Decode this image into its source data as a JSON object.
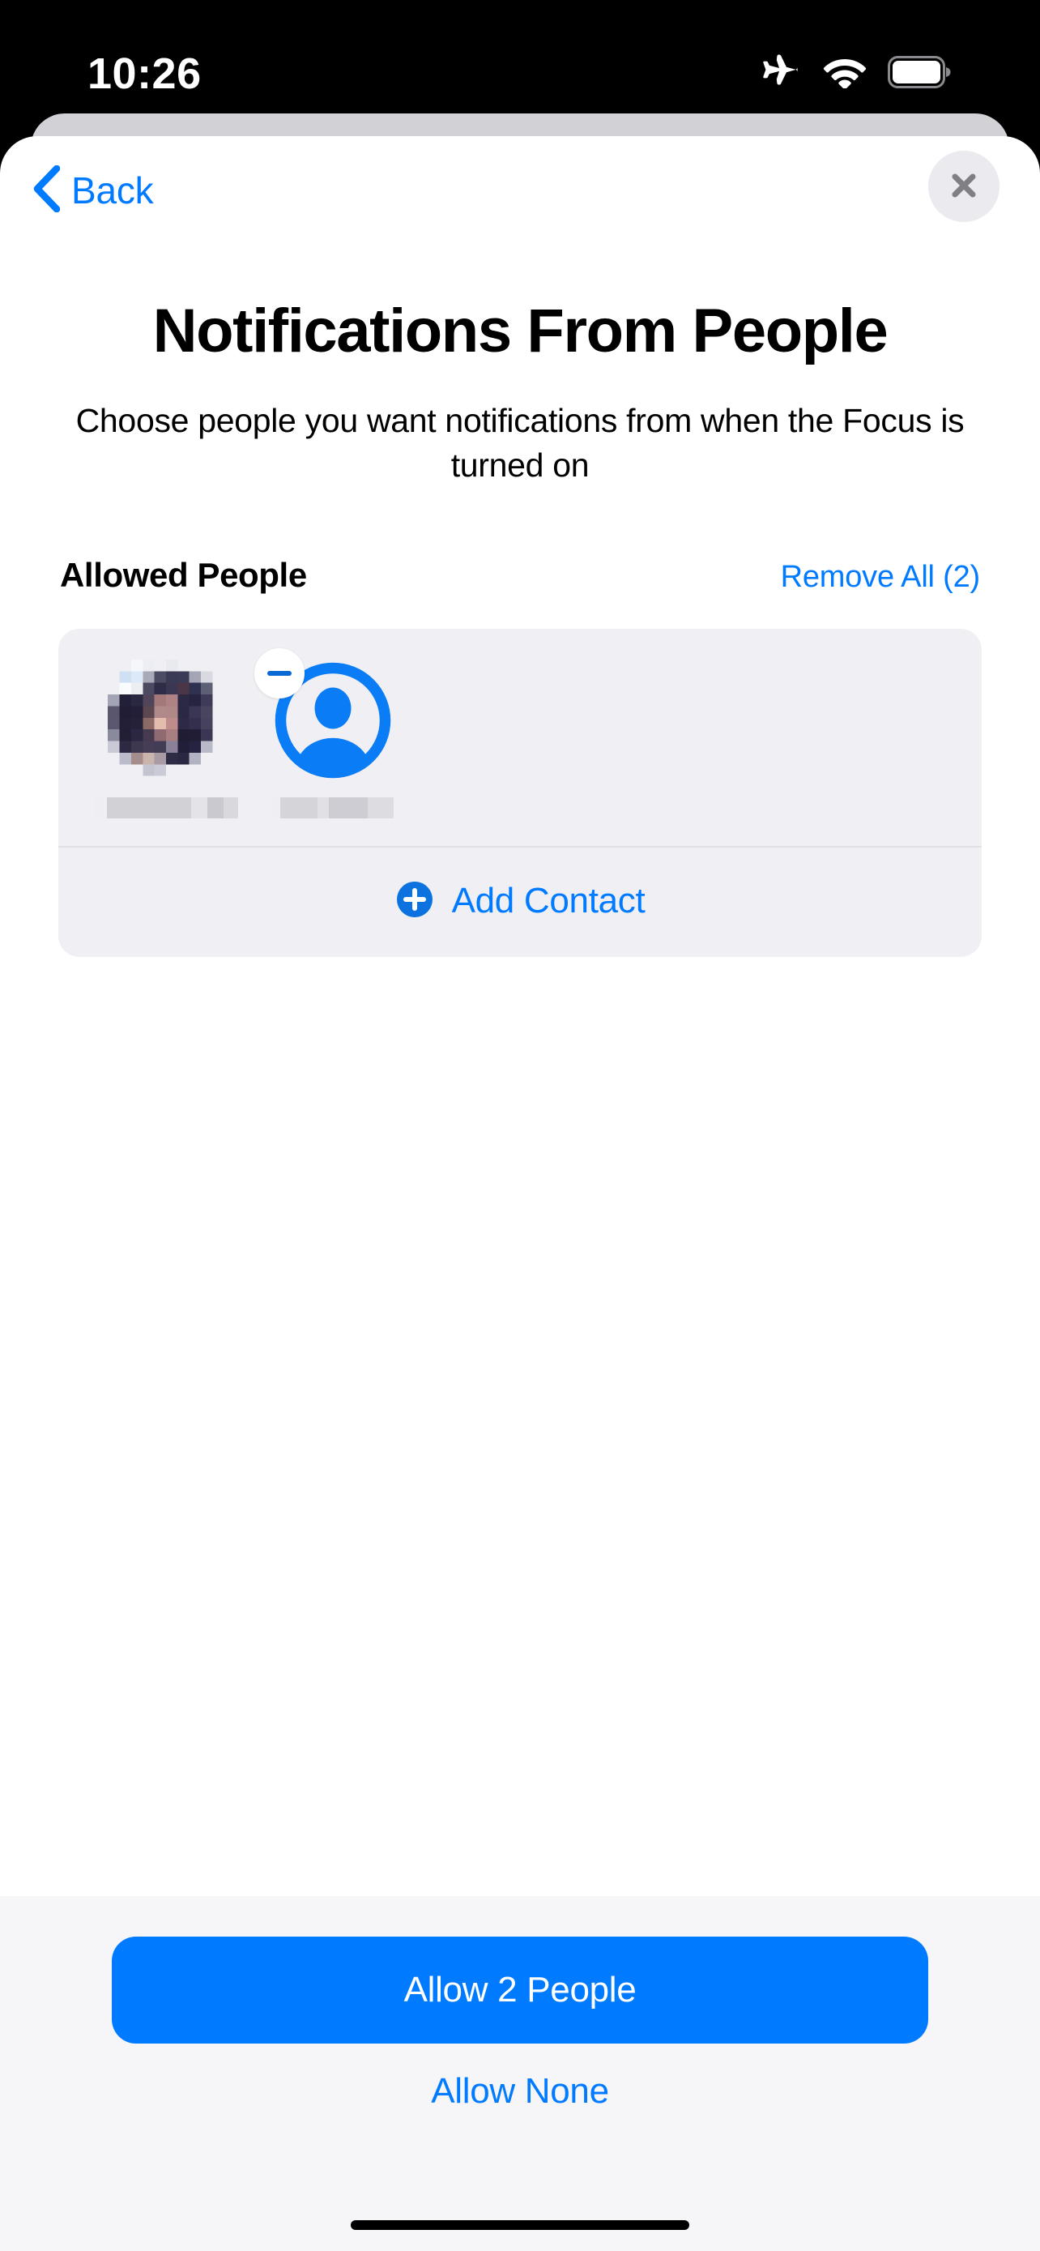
{
  "status_bar": {
    "time": "10:26",
    "icons": [
      "airplane-mode-icon",
      "wifi-icon",
      "battery-icon"
    ],
    "background_color": "#000000",
    "foreground_color": "#FFFFFF"
  },
  "nav": {
    "back_label": "Back",
    "back_icon": "chevron-left-icon",
    "close_icon": "close-icon",
    "accent_color": "#007AFF"
  },
  "header": {
    "title": "Notifications From People",
    "subtitle": "Choose people you want notifications from when the Focus is turned on"
  },
  "section": {
    "title": "Allowed People",
    "remove_all_label": "Remove All (2)"
  },
  "contacts": {
    "items": [
      {
        "name": "",
        "name_redacted": true,
        "avatar_type": "photo",
        "remove_badge": false
      },
      {
        "name": "",
        "name_redacted": true,
        "avatar_type": "placeholder",
        "remove_badge": true,
        "remove_icon": "minus-icon"
      }
    ],
    "add_contact_label": "Add Contact",
    "add_contact_icon": "plus-circle-icon",
    "card_color": "#F0F0F4"
  },
  "footer": {
    "primary_label": "Allow 2 People",
    "secondary_label": "Allow None",
    "primary_color": "#007AFF",
    "background_color": "#F6F6F8"
  }
}
